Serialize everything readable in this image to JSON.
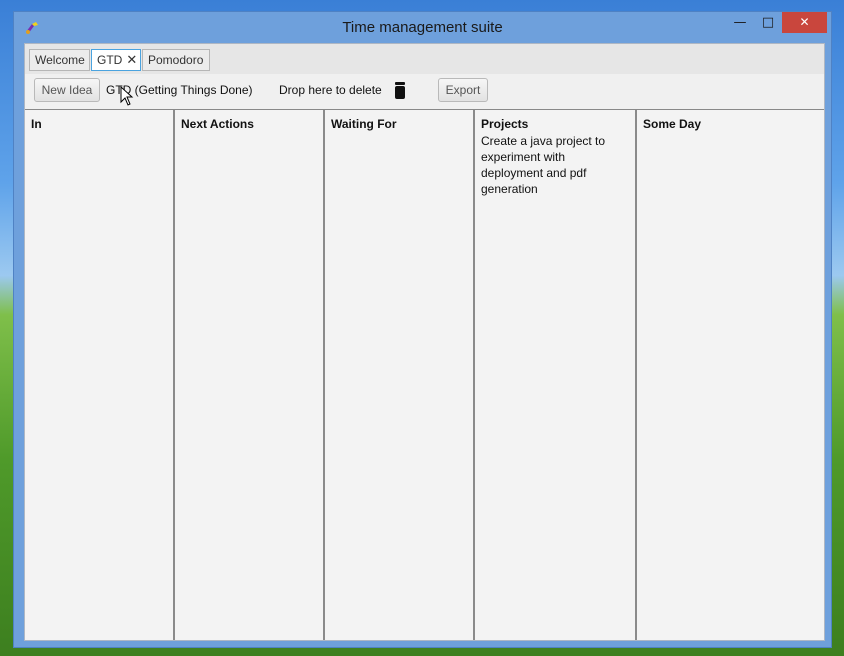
{
  "window": {
    "title": "Time management suite"
  },
  "controls": {
    "minimize": "—",
    "maximize": "□",
    "close": "✕"
  },
  "tabs": [
    {
      "label": "Welcome"
    },
    {
      "label": "GTD",
      "close": "✕"
    },
    {
      "label": "Pomodoro"
    }
  ],
  "toolbar": {
    "new_idea": "New Idea",
    "gtd_label": "GTD (Getting Things Done)",
    "drop_label": "Drop here to delete",
    "export": "Export"
  },
  "columns": [
    {
      "title": "In",
      "items": []
    },
    {
      "title": "Next Actions",
      "items": []
    },
    {
      "title": "Waiting For",
      "items": []
    },
    {
      "title": "Projects",
      "items": [
        "Create a java project to experiment with deployment and pdf generation"
      ]
    },
    {
      "title": "Some Day",
      "items": []
    }
  ],
  "icons": {
    "trash": "trash-icon",
    "app": "app-icon",
    "cursor": "mouse-pointer-icon"
  }
}
